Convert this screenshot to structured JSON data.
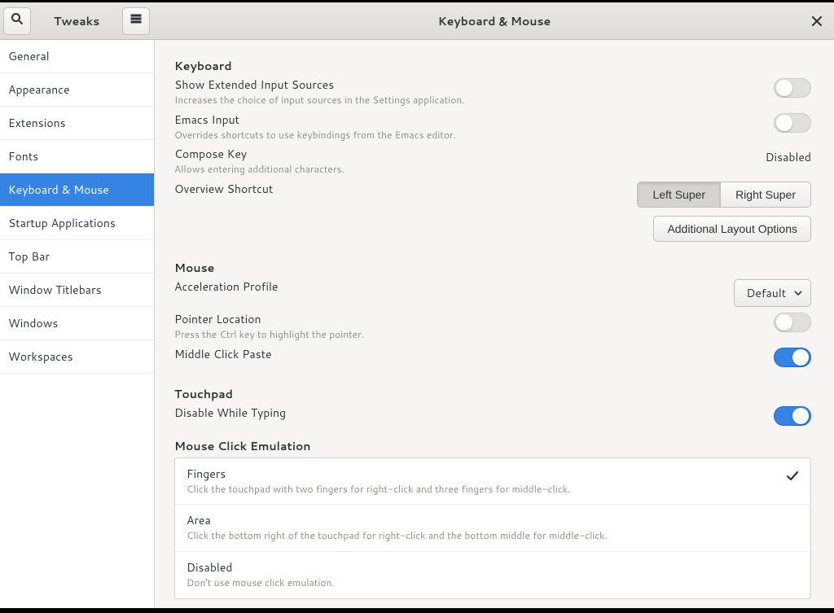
{
  "header": {
    "app_title": "Tweaks",
    "page_title": "Keyboard & Mouse"
  },
  "sidebar": {
    "items": [
      {
        "label": "General"
      },
      {
        "label": "Appearance"
      },
      {
        "label": "Extensions"
      },
      {
        "label": "Fonts"
      },
      {
        "label": "Keyboard & Mouse"
      },
      {
        "label": "Startup Applications"
      },
      {
        "label": "Top Bar"
      },
      {
        "label": "Window Titlebars"
      },
      {
        "label": "Windows"
      },
      {
        "label": "Workspaces"
      }
    ],
    "active_index": 4
  },
  "keyboard": {
    "section": "Keyboard",
    "show_extended": {
      "title": "Show Extended Input Sources",
      "sub": "Increases the choice of input sources in the Settings application."
    },
    "emacs": {
      "title": "Emacs Input",
      "sub": "Overrides shortcuts to use keybindings from the Emacs editor."
    },
    "compose": {
      "title": "Compose Key",
      "sub": "Allows entering additional characters.",
      "value": "Disabled"
    },
    "overview": {
      "title": "Overview Shortcut",
      "left": "Left Super",
      "right": "Right Super"
    },
    "additional_btn": "Additional Layout Options"
  },
  "mouse": {
    "section": "Mouse",
    "accel": {
      "title": "Acceleration Profile",
      "value": "Default"
    },
    "pointer": {
      "title": "Pointer Location",
      "sub": "Press the Ctrl key to highlight the pointer."
    },
    "middle": {
      "title": "Middle Click Paste"
    }
  },
  "touchpad": {
    "section": "Touchpad",
    "disable_typing": {
      "title": "Disable While Typing"
    },
    "emulation_heading": "Mouse Click Emulation",
    "options": [
      {
        "title": "Fingers",
        "sub": "Click the touchpad with two fingers for right-click and three fingers for middle-click."
      },
      {
        "title": "Area",
        "sub": "Click the bottom right of the touchpad for right-click and the bottom middle for middle-click."
      },
      {
        "title": "Disabled",
        "sub": "Don't use mouse click emulation."
      }
    ],
    "selected_index": 0
  }
}
